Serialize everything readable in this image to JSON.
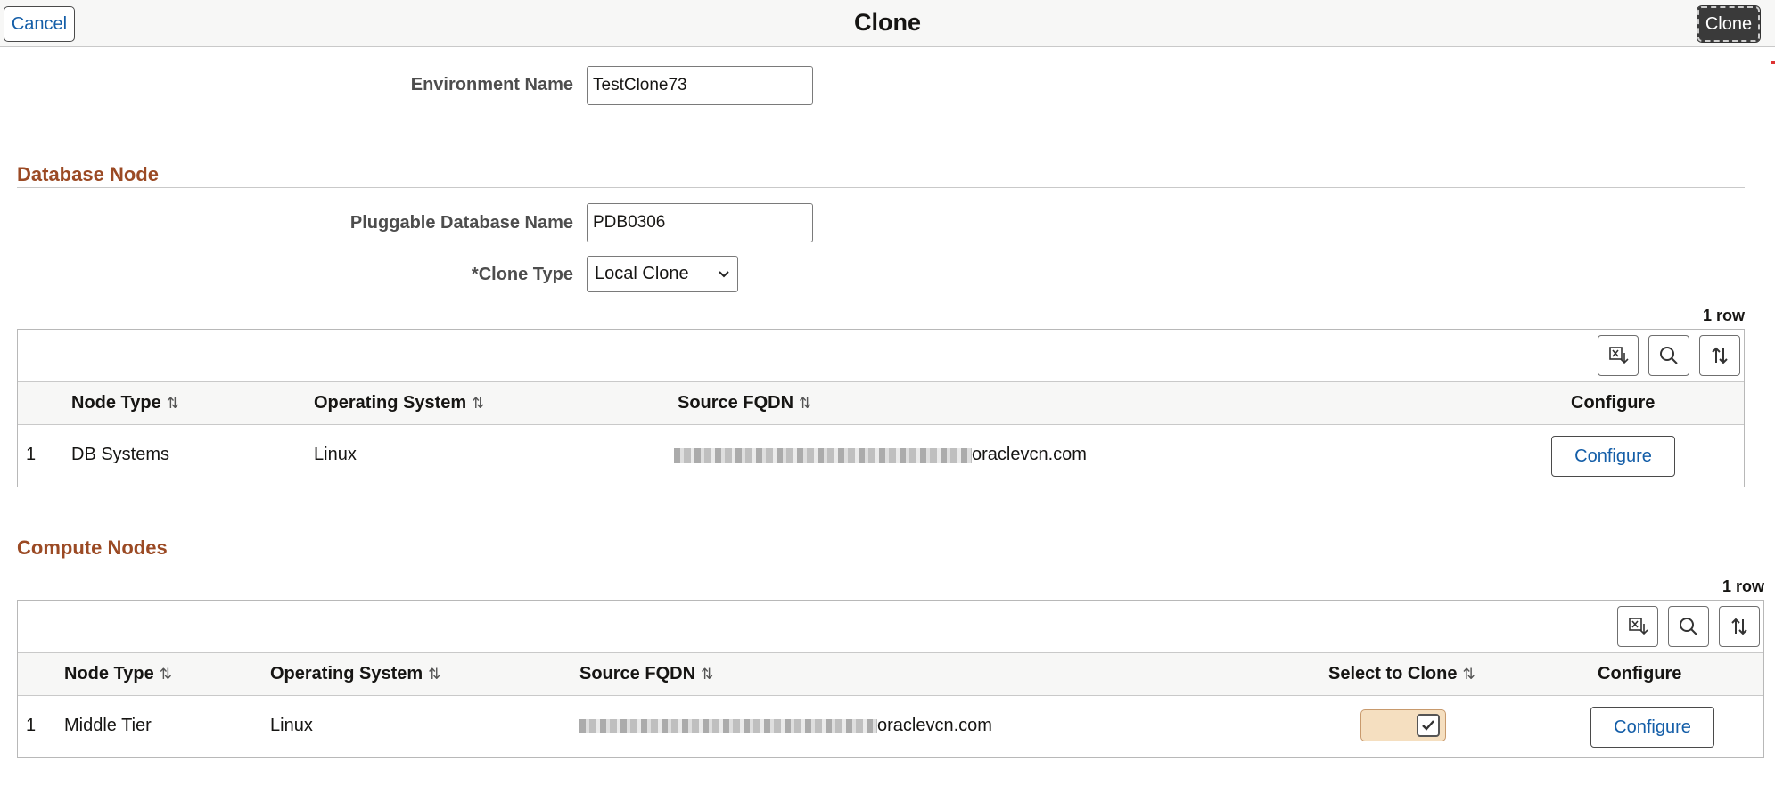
{
  "header": {
    "cancel_label": "Cancel",
    "title": "Clone",
    "clone_label": "Clone"
  },
  "environment": {
    "label": "Environment Name",
    "value": "TestClone73"
  },
  "database_node": {
    "section_title": "Database Node",
    "pdb_label": "Pluggable Database Name",
    "pdb_value": "PDB0306",
    "clone_type_label": "*Clone Type",
    "clone_type_value": "Local Clone",
    "row_count": "1 row",
    "columns": {
      "node_type": "Node Type",
      "os": "Operating System",
      "fqdn": "Source FQDN",
      "configure": "Configure"
    },
    "rows": [
      {
        "num": "1",
        "node_type": "DB Systems",
        "os": "Linux",
        "fqdn_suffix": "oraclevcn.com",
        "configure_label": "Configure"
      }
    ]
  },
  "compute_nodes": {
    "section_title": "Compute Nodes",
    "row_count": "1 row",
    "columns": {
      "node_type": "Node Type",
      "os": "Operating System",
      "fqdn": "Source FQDN",
      "select": "Select to Clone",
      "configure": "Configure"
    },
    "rows": [
      {
        "num": "1",
        "node_type": "Middle Tier",
        "os": "Linux",
        "fqdn_suffix": "oraclevcn.com",
        "selected": true,
        "configure_label": "Configure"
      }
    ]
  },
  "icons": {
    "export": "export-to-excel-icon",
    "search": "search-icon",
    "sort": "sort-icon",
    "chevron": "chevron-down-icon",
    "check": "checkmark-icon"
  },
  "colors": {
    "section_title": "#9b4a24",
    "link": "#145ea8",
    "toggle_bg": "#f5dfc0",
    "primary_button": "#3a3a3a"
  }
}
